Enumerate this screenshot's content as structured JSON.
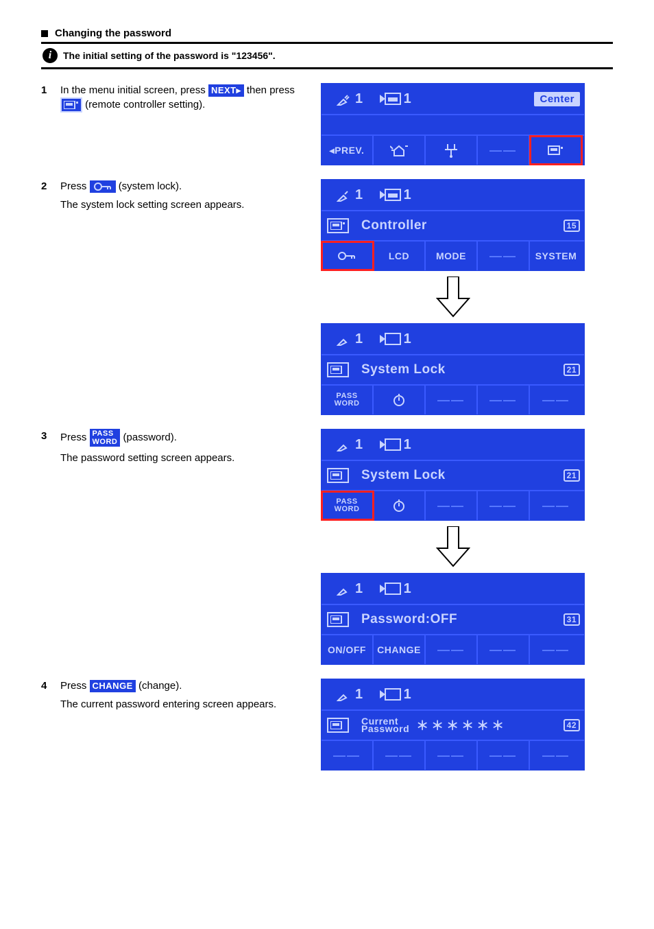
{
  "heading": "Changing the password",
  "note": "The initial setting of the password is \"123456\".",
  "steps": {
    "s1": {
      "num": "1",
      "line1_pre": "In the menu initial screen, press ",
      "next_label": "NEXT▸",
      "line2_pre": " then press ",
      "line2_post": " (remote controller setting)."
    },
    "s2": {
      "num": "2",
      "pre": "Press ",
      "post": " (system lock).",
      "desc": "The system lock setting screen appears."
    },
    "s3": {
      "num": "3",
      "pre": "Press ",
      "post": " (password).",
      "desc": "The password setting screen appears.",
      "pass_top": "PASS",
      "pass_bot": "WORD"
    },
    "s4": {
      "num": "4",
      "pre": "Press ",
      "change_label": "CHANGE",
      "post": " (change).",
      "desc": "The current password entering screen appears."
    }
  },
  "lcd": {
    "one": "1",
    "center": "Center",
    "prev": "◂PREV.",
    "controller": "Controller",
    "n15": "15",
    "lcd": "LCD",
    "mode": "MODE",
    "system": "SYSTEM",
    "syslock": "System Lock",
    "n21": "21",
    "pass_top": "PASS",
    "pass_bot": "WORD",
    "pwdoff": "Password:OFF",
    "n31": "31",
    "onoff": "ON/OFF",
    "change": "CHANGE",
    "curpwd_top": "Current",
    "curpwd_bot": "Password",
    "mask": "＊＊＊＊＊＊",
    "n42": "42",
    "dash": "——"
  }
}
